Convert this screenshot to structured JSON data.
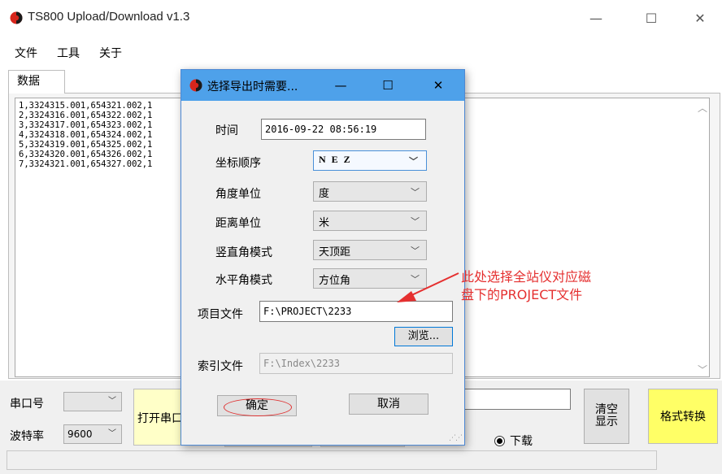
{
  "window": {
    "title": "TS800 Upload/Download  v1.3",
    "minimize": "—",
    "maximize": "☐",
    "close": "✕"
  },
  "menu": [
    "文件",
    "工具",
    "关于"
  ],
  "tab": {
    "label": "数据"
  },
  "data_lines": [
    "1,3324315.001,654321.002,1",
    "2,3324316.001,654322.002,1",
    "3,3324317.001,654323.002,1",
    "4,3324318.001,654324.002,1",
    "5,3324319.001,654325.002,1",
    "6,3324320.001,654326.002,1",
    "7,3324321.001,654327.002,1"
  ],
  "bottom": {
    "com_label": "串口号",
    "com_value": "",
    "baud_label": "波特率",
    "baud_value": "9600",
    "open_port": "打开串口",
    "clear_line1": "清空",
    "clear_line2": "显示",
    "convert": "格式转换",
    "download": "下载"
  },
  "dialog": {
    "title": "选择导出时需要...",
    "minimize": "—",
    "maximize": "☐",
    "close": "✕",
    "time_label": "时间",
    "time_value": "2016-09-22 08:56:19",
    "order_label": "坐标顺序",
    "order_value": "N E Z",
    "angle_unit_label": "角度单位",
    "angle_unit_value": "度",
    "dist_unit_label": "距离单位",
    "dist_unit_value": "米",
    "vmode_label": "竖直角模式",
    "vmode_value": "天顶距",
    "hmode_label": "水平角模式",
    "hmode_value": "方位角",
    "project_label": "项目文件",
    "project_value": "F:\\PROJECT\\2233",
    "browse": "浏览...",
    "index_label": "索引文件",
    "index_value": "F:\\Index\\2233",
    "ok": "确定",
    "cancel": "取消"
  },
  "annotation": {
    "line1": "此处选择全站仪对应磁",
    "line2": "盘下的PROJECT文件",
    "color": "#e53030"
  },
  "icons": {
    "app_icon": "red-black-circle-icon",
    "dropdown": "chevron-down-icon"
  }
}
